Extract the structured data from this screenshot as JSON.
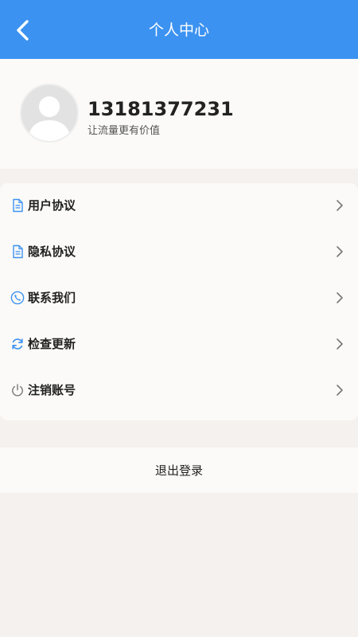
{
  "header": {
    "title": "个人中心",
    "back_icon": "back-arrow-icon",
    "background": "#3c92f1"
  },
  "profile": {
    "avatar_icon": "default-avatar-icon",
    "phone": "13181377231",
    "slogan": "让流量更有价值"
  },
  "menu": {
    "items": [
      {
        "label": "用户协议",
        "icon": "document-icon"
      },
      {
        "label": "隐私协议",
        "icon": "document-icon"
      },
      {
        "label": "联系我们",
        "icon": "phone-icon"
      },
      {
        "label": "检查更新",
        "icon": "refresh-icon"
      },
      {
        "label": "注销账号",
        "icon": "power-icon"
      }
    ],
    "chevron_icon": "chevron-right-icon",
    "accent": "#3c92f1"
  },
  "logout": {
    "label": "退出登录"
  }
}
